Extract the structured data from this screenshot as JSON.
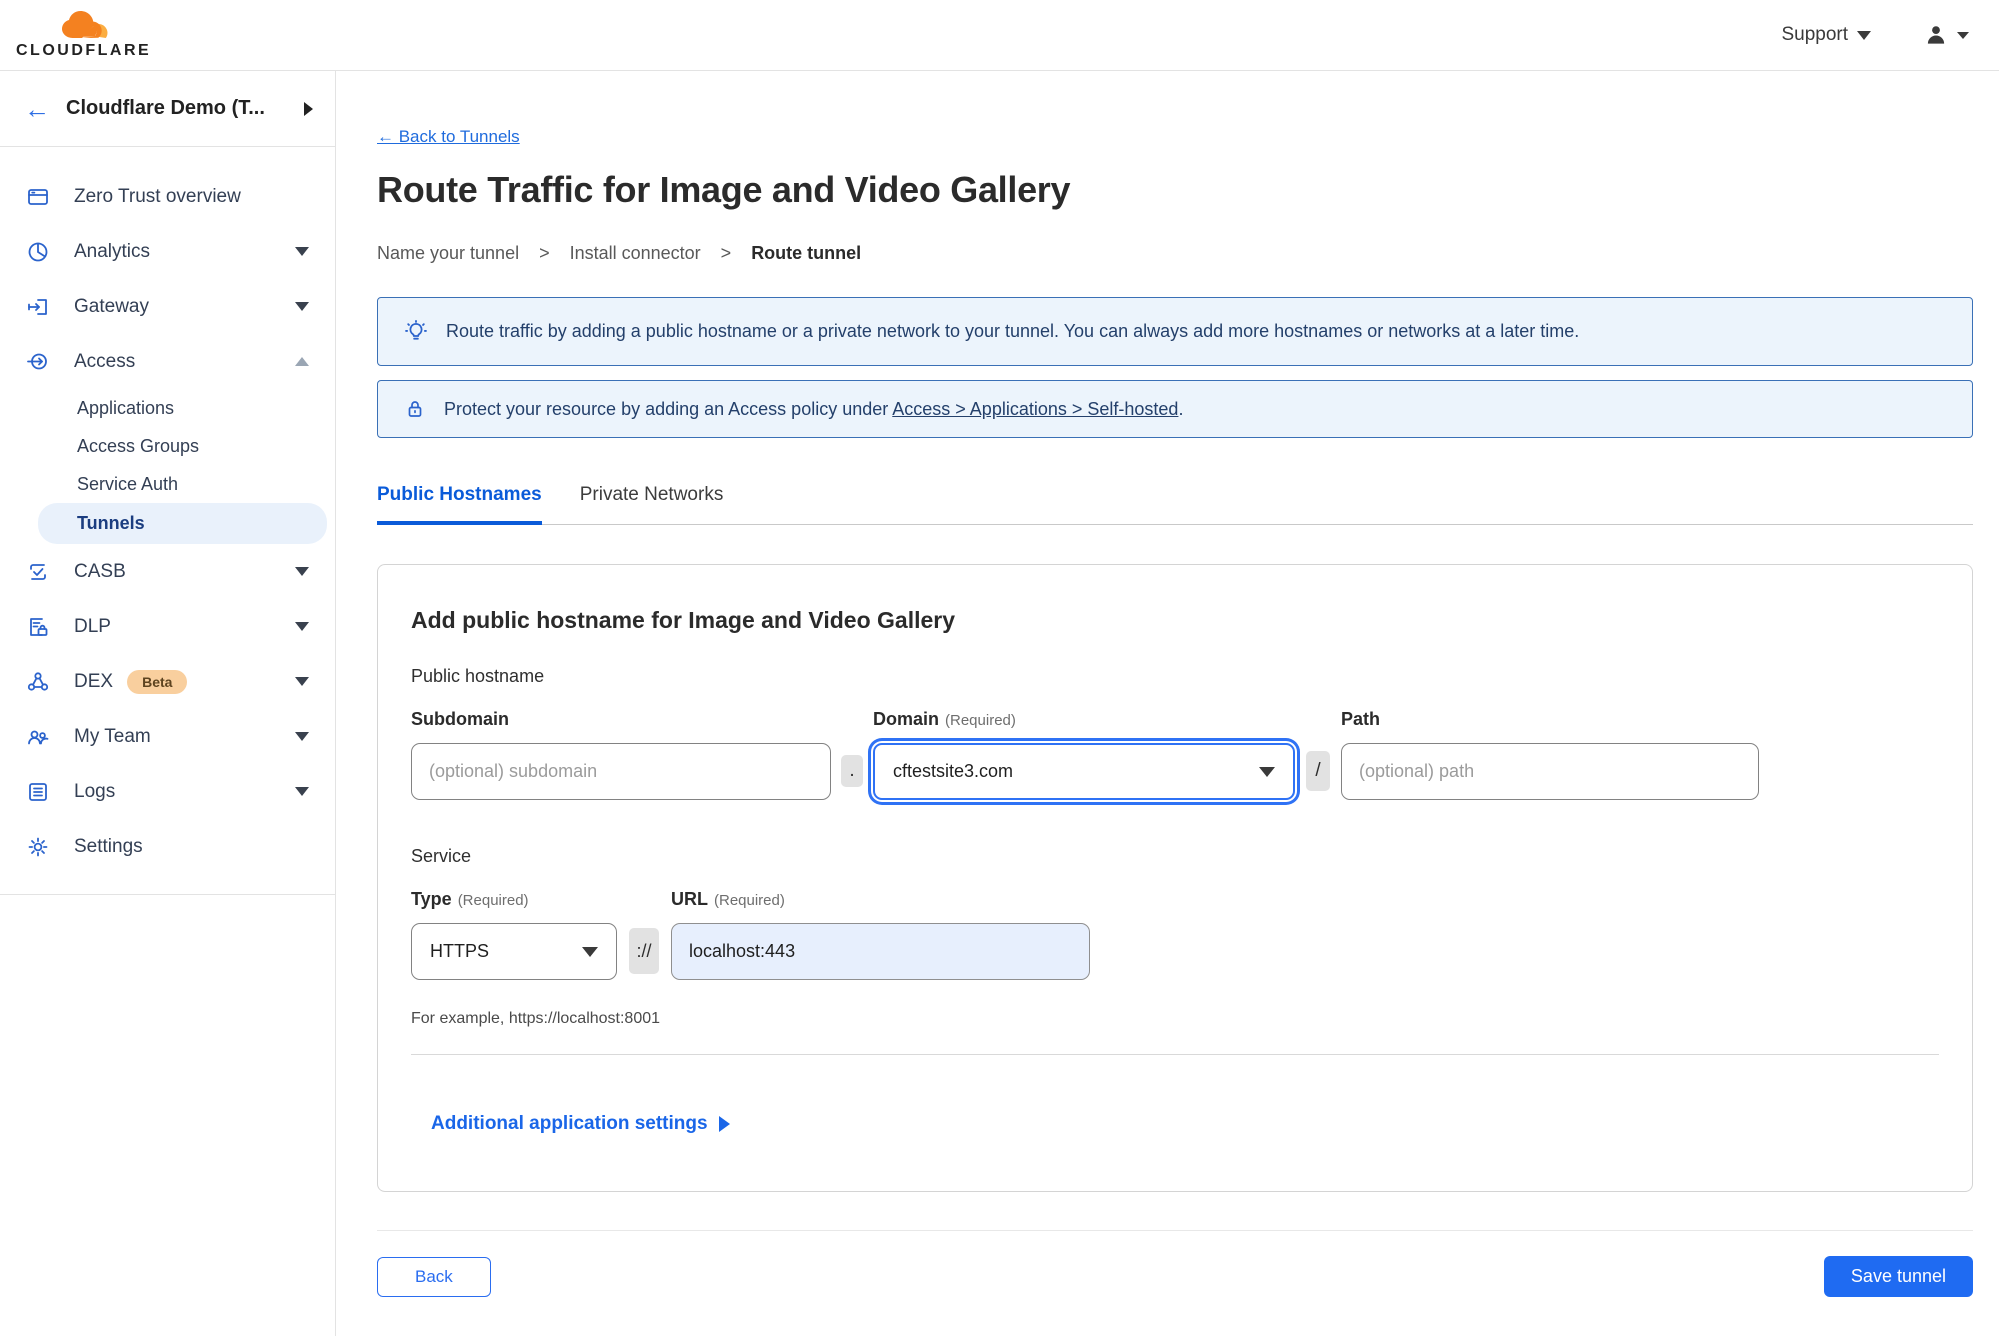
{
  "header": {
    "brand": "CLOUDFLARE",
    "support_label": "Support"
  },
  "sidebar": {
    "account_name": "Cloudflare Demo (T...",
    "items": [
      {
        "label": "Zero Trust overview"
      },
      {
        "label": "Analytics"
      },
      {
        "label": "Gateway"
      },
      {
        "label": "Access"
      },
      {
        "label": "CASB"
      },
      {
        "label": "DLP"
      },
      {
        "label": "DEX",
        "badge": "Beta"
      },
      {
        "label": "My Team"
      },
      {
        "label": "Logs"
      },
      {
        "label": "Settings"
      }
    ],
    "access_children": [
      {
        "label": "Applications"
      },
      {
        "label": "Access Groups"
      },
      {
        "label": "Service Auth"
      },
      {
        "label": "Tunnels",
        "selected": true
      }
    ]
  },
  "main": {
    "back_link": "← Back to Tunnels",
    "title": "Route Traffic for Image and Video Gallery",
    "step_separator": ">",
    "steps": [
      {
        "label": "Name your tunnel"
      },
      {
        "label": "Install connector"
      },
      {
        "label": "Route tunnel",
        "current": true
      }
    ],
    "banners": {
      "tip_text": "Route traffic by adding a public hostname or a private network to your tunnel. You can always add more hostnames or networks at a later time.",
      "protect_text_before": "Protect your resource by adding an Access policy under ",
      "protect_link": "Access > Applications > Self-hosted",
      "protect_text_after": "."
    },
    "tabs": [
      {
        "label": "Public Hostnames",
        "active": true
      },
      {
        "label": "Private Networks"
      }
    ],
    "form": {
      "heading": "Add public hostname for Image and Video Gallery",
      "public_hostname_label": "Public hostname",
      "subdomain": {
        "label": "Subdomain",
        "placeholder": "(optional) subdomain"
      },
      "dot_separator": ".",
      "domain": {
        "label": "Domain",
        "required": "(Required)",
        "value": "cftestsite3.com"
      },
      "slash_separator": "/",
      "path": {
        "label": "Path",
        "placeholder": "(optional) path"
      },
      "service_label": "Service",
      "type": {
        "label": "Type",
        "required": "(Required)",
        "value": "HTTPS"
      },
      "scheme_separator": "://",
      "url": {
        "label": "URL",
        "required": "(Required)",
        "value": "localhost:443"
      },
      "example": "For example, https://localhost:8001",
      "additional_settings": "Additional application settings"
    },
    "footer": {
      "back": "Back",
      "save": "Save tunnel"
    }
  },
  "colors": {
    "accent_blue": "#1f6bf2",
    "link_blue": "#1f6bdd",
    "tab_blue": "#0a5bd9",
    "icon_blue": "#2b63cc",
    "banner_bg": "#ecf4fc",
    "banner_border": "#3a70b6",
    "banner_text": "#24406b",
    "selected_pill_bg": "#e9f1fb",
    "selected_pill_text": "#1b3d80",
    "beta_badge_bg": "#f9cf9e",
    "url_autofill_bg": "#e7effd"
  }
}
